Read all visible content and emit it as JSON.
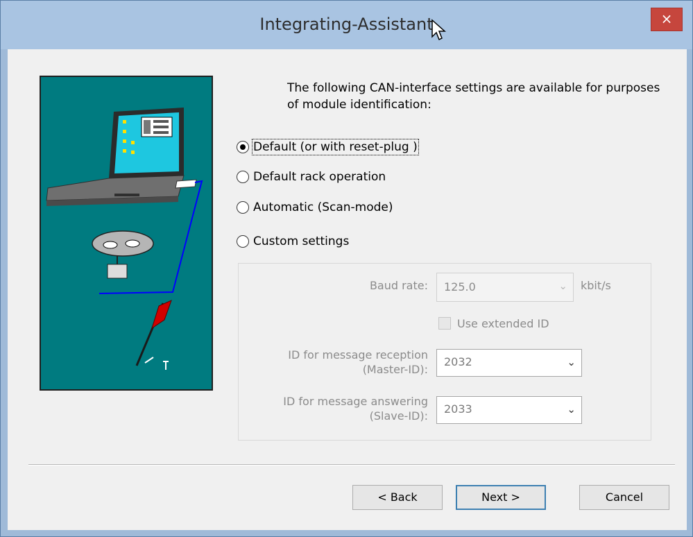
{
  "window": {
    "title": "Integrating-Assistant",
    "close_label": "×"
  },
  "intro": {
    "text": "The following CAN-interface settings are available for purposes of module identification:"
  },
  "options": [
    {
      "label": "Default (or with reset-plug )",
      "selected": true
    },
    {
      "label": "Default rack operation",
      "selected": false
    },
    {
      "label": "Automatic (Scan-mode)",
      "selected": false
    },
    {
      "label": "Custom settings",
      "selected": false
    }
  ],
  "custom": {
    "baud_label": "Baud rate:",
    "baud_value": "125.0",
    "baud_unit": "kbit/s",
    "extended_id_label": "Use extended ID",
    "master_label_line1": "ID for message reception",
    "master_label_line2": "(Master-ID):",
    "master_value": "2032",
    "slave_label_line1": "ID for message answering",
    "slave_label_line2": "(Slave-ID):",
    "slave_value": "2033"
  },
  "buttons": {
    "back": "< Back",
    "next": "Next >",
    "cancel": "Cancel"
  },
  "icons": {
    "close": "close-icon",
    "dropdown": "chevron-down-icon",
    "cursor": "mouse-pointer-icon"
  },
  "colors": {
    "art_background": "#007b80",
    "close_button": "#c6463d",
    "default_button_border": "#3c7fb1"
  }
}
